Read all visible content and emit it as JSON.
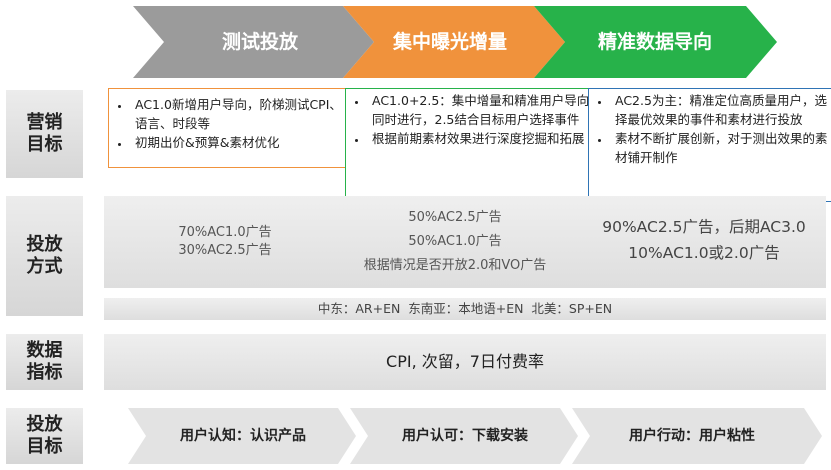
{
  "stages": [
    {
      "label": "测试投放",
      "color": "#9b9b9b"
    },
    {
      "label": "集中曝光增量",
      "color": "#f0923c"
    },
    {
      "label": "精准数据导向",
      "color": "#27b24a"
    }
  ],
  "rows": {
    "marketing_goal": "营销\n目标",
    "delivery_method": "投放\n方式",
    "data_metrics": "数据\n指标",
    "delivery_goal": "投放\n目标"
  },
  "marketing_boxes": [
    {
      "border": "#f0923c",
      "bullets": [
        "AC1.0新增用户导向，阶梯测试CPI、语言、时段等",
        "初期出价&预算&素材优化"
      ]
    },
    {
      "border": "#27b24a",
      "bullets": [
        "AC1.0+2.5：集中增量和精准用户导向同时进行，2.5结合目标用户选择事件",
        "根据前期素材效果进行深度挖掘和拓展"
      ]
    },
    {
      "border": "#2f74b5",
      "bullets": [
        "AC2.5为主：精准定位高质量用户，选择最优效果的事件和素材进行投放",
        "素材不断扩展创新，对于测出效果的素材铺开制作"
      ]
    }
  ],
  "delivery": {
    "col1": [
      "70%AC1.0广告",
      "30%AC2.5广告"
    ],
    "col2": [
      "50%AC2.5广告",
      "50%AC1.0广告",
      "根据情况是否开放2.0和VO广告"
    ],
    "col3": [
      "90%AC2.5广告，后期AC3.0",
      "10%AC1.0或2.0广告"
    ],
    "regions": "中东：AR+EN  东南亚：本地语+EN  北美：SP+EN"
  },
  "metrics": "CPI, 次留，7日付费率",
  "goals": [
    "用户认知：认识产品",
    "用户认可：下载安装",
    "用户行动：用户粘性"
  ]
}
